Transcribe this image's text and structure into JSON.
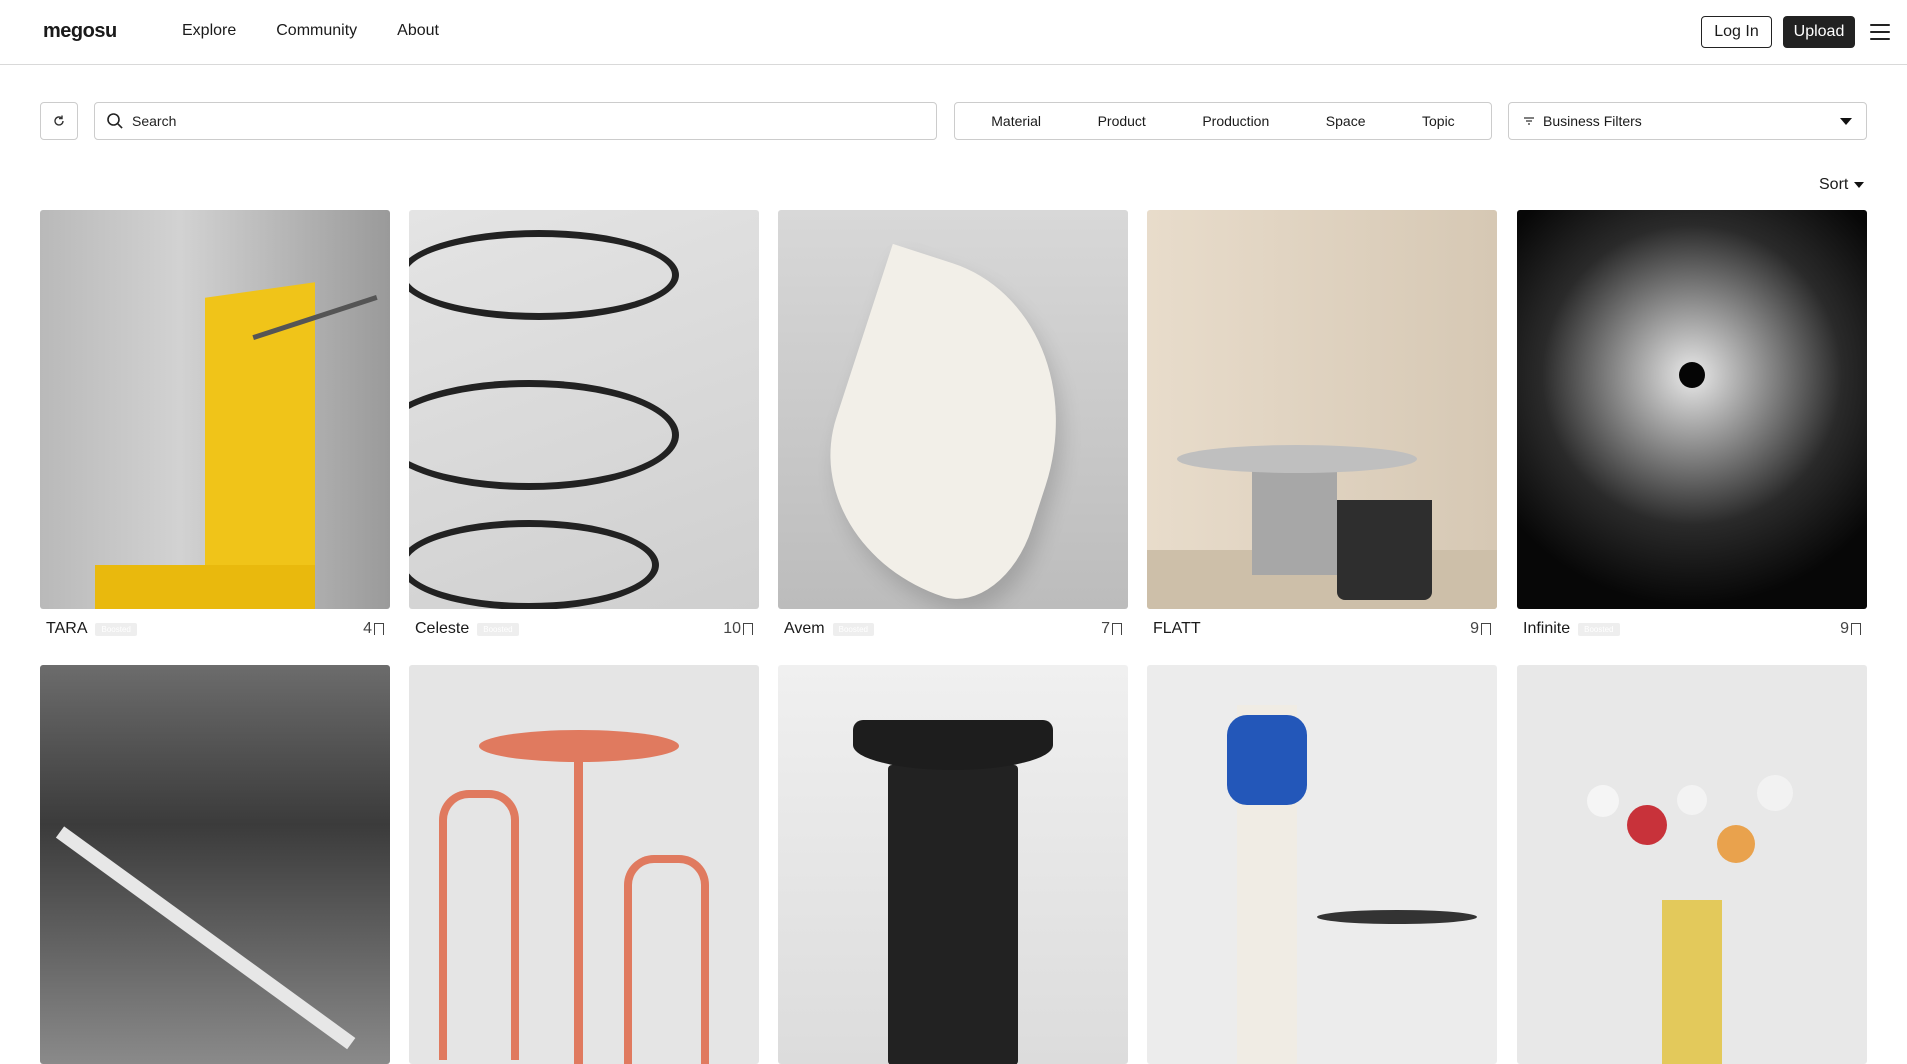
{
  "app": {
    "logo": "megosu",
    "nav": [
      "Explore",
      "Community",
      "About"
    ],
    "login_label": "Log In",
    "upload_label": "Upload"
  },
  "filters": {
    "search_placeholder": "Search",
    "categories": [
      "Material",
      "Product",
      "Production",
      "Space",
      "Topic"
    ],
    "business_filters": "Business Filters",
    "sort_label": "Sort"
  },
  "badge_text": "Boosted",
  "cards_row1": [
    {
      "title": "TARA",
      "count": "4",
      "boosted": true
    },
    {
      "title": "Celeste",
      "count": "10",
      "boosted": true
    },
    {
      "title": "Avem",
      "count": "7",
      "boosted": true
    },
    {
      "title": "FLATT",
      "count": "9",
      "boosted": false
    },
    {
      "title": "Infinite",
      "count": "9",
      "boosted": true
    }
  ],
  "colors": {
    "primary_dark": "#222222",
    "border": "#cccccc",
    "badge_bg": "#eeeeee"
  }
}
